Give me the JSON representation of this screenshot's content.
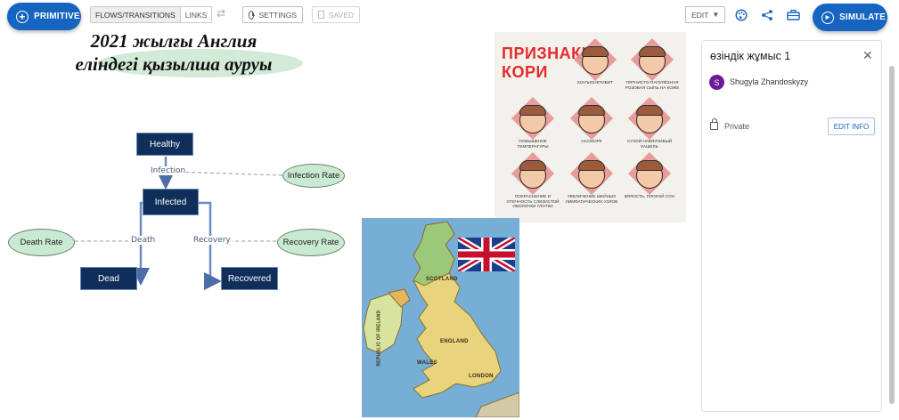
{
  "toolbar": {
    "primitive_label": "PRIMITIVE",
    "flows_label": "FLOWS/TRANSITIONS",
    "links_label": "LINKS",
    "settings_label": "SETTINGS",
    "saved_label": "SAVED",
    "edit_label": "EDIT",
    "simulate_label": "SIMULATE",
    "icons": [
      "plus-circle-icon",
      "swap-icon",
      "clock-icon",
      "save-icon",
      "palette-icon",
      "share-icon",
      "toolbox-icon",
      "play-icon"
    ],
    "accent_color": "#1565c0"
  },
  "canvas": {
    "title_lines": [
      "2021 жылғы Англия",
      "еліндегі қызылша ауруы"
    ],
    "stocks": [
      "Healthy",
      "Infected",
      "Dead",
      "Recovered"
    ],
    "flows": [
      "Infection",
      "Death",
      "Recovery"
    ],
    "variables": [
      "Infection Rate",
      "Death Rate",
      "Recovery Rate"
    ]
  },
  "measles_poster": {
    "title_lines": [
      "ПРИЗНАКИ",
      "КОРИ"
    ],
    "symptoms": [
      "КОНЪЮНКТИВИТ",
      "ПЯТНИСТО-ПАПУЛЁЗНАЯ РОЗОВАЯ СЫПЬ НА КОЖЕ",
      "ПОВЫШЕНИЕ ТЕМПЕРАТУРЫ",
      "НАСМОРК",
      "СУХОЙ НАВЯЗЧИВЫЙ КАШЕЛЬ",
      "ПОКРАСНЕНИЕ И ОТЕЧНОСТЬ СЛИЗИСТОЙ ОБОЛОЧКИ ГЛОТКИ",
      "УВЕЛИЧЕНИЕ ШЕЙНЫХ ЛИМФАТИЧЕСКИХ УЗЛОВ",
      "ВЯЛОСТЬ, ПЛОХОЙ СОН"
    ]
  },
  "uk_map": {
    "labels": [
      "SCOTLAND",
      "REPUBLIC OF IRELAND",
      "ENGLAND",
      "WALES",
      "LONDON"
    ]
  },
  "panel": {
    "title": "өзіндік жұмыс 1",
    "avatar_initial": "S",
    "user_name": "Shugyla Zhandoskyzy",
    "visibility": "Private",
    "edit_info_label": "EDIT INFO"
  }
}
